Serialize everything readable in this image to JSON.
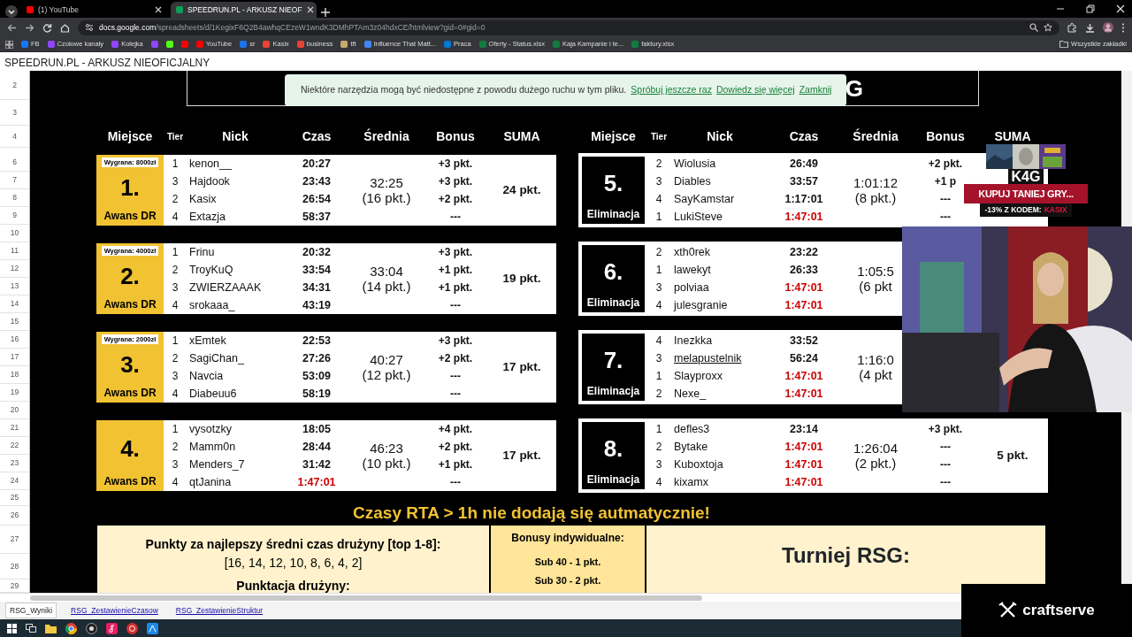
{
  "browser": {
    "tabs": [
      {
        "label": "(1) YouTube",
        "color": "#ff0000",
        "selected": false
      },
      {
        "label": "SPEEDRUN.PL - ARKUSZ NIEOF",
        "color": "#0f9d58",
        "selected": true
      }
    ],
    "url": {
      "host": "docs.google.com",
      "path": "/spreadsheets/d/1KegixF6Q2B4awhqCEzeW1wndK3DMhPTAm3z04hdxCE/htmlview?gid=0#gid=0"
    },
    "bookmarks": [
      {
        "label": "FB",
        "color": "#1877f2"
      },
      {
        "label": "Czołowe kanały",
        "color": "#9146ff"
      },
      {
        "label": "Kolejka",
        "color": "#9146ff"
      },
      {
        "color": "#9146ff"
      },
      {
        "color": "#53fc18"
      },
      {
        "color": "#ff0000"
      },
      {
        "label": "YouTube",
        "color": "#ff0000"
      },
      {
        "label": "sr",
        "color": "#1a73e8"
      },
      {
        "label": "Kasix",
        "color": "#ea4335"
      },
      {
        "label": "business",
        "color": "#ea4335"
      },
      {
        "label": "tft",
        "color": "#c8aa6e"
      },
      {
        "label": "Influence That Matt...",
        "color": "#4285f4"
      },
      {
        "label": "Praca",
        "color": "#0078d4"
      },
      {
        "label": "Oferty - Status.xlsx",
        "color": "#107c41"
      },
      {
        "label": "Kaja Kampanie i te...",
        "color": "#107c41"
      },
      {
        "label": "faktury.xlsx",
        "color": "#107c41"
      }
    ],
    "all_bookmarks": "Wszystkie zakładki"
  },
  "sheet": {
    "title": "SPEEDRUN.PL - ARKUSZ NIEOFICJALNY",
    "row_numbers": [
      "2",
      "3",
      "4",
      "6",
      "7",
      "8",
      "9",
      "10",
      "11",
      "12",
      "13",
      "14",
      "15",
      "16",
      "17",
      "18",
      "19",
      "20",
      "21",
      "22",
      "23",
      "24",
      "25",
      "26",
      "27",
      "28",
      "29"
    ],
    "banner": "G",
    "notice": {
      "text": "Niektóre narzędzia mogą być niedostępne z powodu dużego ruchu w tym pliku.",
      "links": [
        "Spróbuj jeszcze raz",
        "Dowiedz się więcej",
        "Zamknij"
      ]
    },
    "headers": [
      [
        "Miejsce",
        "Tier",
        "Nick",
        "Czas",
        "Średnia",
        "Bonus",
        "SUMA"
      ],
      [
        "Miejsce",
        "Tier",
        "Nick",
        "Czas",
        "Średnia",
        "Bonus",
        "SUMA"
      ]
    ],
    "teams": [
      {
        "place": "1.",
        "prize": "Wygrana: 8000zł",
        "status": "Awans DR",
        "kind": "advance",
        "average": "32:25",
        "avg_points": "(16 pkt.)",
        "total": "24 pkt.",
        "players": [
          {
            "tier": "1",
            "nick": "kenon__",
            "time": "20:27",
            "over_limit": false,
            "hovered": false,
            "bonus": "+3 pkt."
          },
          {
            "tier": "3",
            "nick": "Hajdook",
            "time": "23:43",
            "over_limit": false,
            "hovered": false,
            "bonus": "+3 pkt."
          },
          {
            "tier": "2",
            "nick": "Kasix",
            "time": "26:54",
            "over_limit": false,
            "hovered": false,
            "bonus": "+2 pkt."
          },
          {
            "tier": "4",
            "nick": "Extazja",
            "time": "58:37",
            "over_limit": false,
            "hovered": false,
            "bonus": "---"
          }
        ]
      },
      {
        "place": "2.",
        "prize": "Wygrana: 4000zł",
        "status": "Awans DR",
        "kind": "advance",
        "average": "33:04",
        "avg_points": "(14 pkt.)",
        "total": "19 pkt.",
        "players": [
          {
            "tier": "1",
            "nick": "Frinu",
            "time": "20:32",
            "over_limit": false,
            "hovered": false,
            "bonus": "+3 pkt."
          },
          {
            "tier": "2",
            "nick": "TroyKuQ",
            "time": "33:54",
            "over_limit": false,
            "hovered": false,
            "bonus": "+1 pkt."
          },
          {
            "tier": "3",
            "nick": "ZWIERZAAAK",
            "time": "34:31",
            "over_limit": false,
            "hovered": false,
            "bonus": "+1 pkt."
          },
          {
            "tier": "4",
            "nick": "srokaaa_",
            "time": "43:19",
            "over_limit": false,
            "hovered": false,
            "bonus": "---"
          }
        ]
      },
      {
        "place": "3.",
        "prize": "Wygrana: 2000zł",
        "status": "Awans DR",
        "kind": "advance",
        "average": "40:27",
        "avg_points": "(12 pkt.)",
        "total": "17 pkt.",
        "players": [
          {
            "tier": "1",
            "nick": "xEmtek",
            "time": "22:53",
            "over_limit": false,
            "hovered": false,
            "bonus": "+3 pkt."
          },
          {
            "tier": "2",
            "nick": "SagiChan_",
            "time": "27:26",
            "over_limit": false,
            "hovered": false,
            "bonus": "+2 pkt."
          },
          {
            "tier": "3",
            "nick": "Navcia",
            "time": "53:09",
            "over_limit": false,
            "hovered": false,
            "bonus": "---"
          },
          {
            "tier": "4",
            "nick": "Diabeuu6",
            "time": "58:19",
            "over_limit": false,
            "hovered": false,
            "bonus": "---"
          }
        ]
      },
      {
        "place": "4.",
        "status": "Awans DR",
        "kind": "advance",
        "average": "46:23",
        "avg_points": "(10 pkt.)",
        "total": "17 pkt.",
        "players": [
          {
            "tier": "1",
            "nick": "vysotzky",
            "time": "18:05",
            "over_limit": false,
            "hovered": false,
            "bonus": "+4 pkt."
          },
          {
            "tier": "2",
            "nick": "Mamm0n",
            "time": "28:44",
            "over_limit": false,
            "hovered": false,
            "bonus": "+2 pkt."
          },
          {
            "tier": "3",
            "nick": "Menders_7",
            "time": "31:42",
            "over_limit": false,
            "hovered": false,
            "bonus": "+1 pkt."
          },
          {
            "tier": "4",
            "nick": "qtJanina",
            "time": "1:47:01",
            "over_limit": true,
            "hovered": false,
            "bonus": "---"
          }
        ]
      },
      {
        "place": "5.",
        "status": "Eliminacja",
        "kind": "elimination",
        "average": "1:01:12",
        "avg_points": "(8 pkt.)",
        "players": [
          {
            "tier": "2",
            "nick": "Wiolusia",
            "time": "26:49",
            "over_limit": false,
            "hovered": false,
            "bonus": "+2 pkt."
          },
          {
            "tier": "3",
            "nick": "Diables",
            "time": "33:57",
            "over_limit": false,
            "hovered": false,
            "bonus": "+1 p"
          },
          {
            "tier": "4",
            "nick": "SayKamstar",
            "time": "1:17:01",
            "over_limit": false,
            "hovered": false,
            "bonus": "---"
          },
          {
            "tier": "1",
            "nick": "LukiSteve",
            "time": "1:47:01",
            "over_limit": true,
            "hovered": false,
            "bonus": "---"
          }
        ]
      },
      {
        "place": "6.",
        "status": "Eliminacja",
        "kind": "elimination",
        "average": "1:05:5",
        "avg_points": "(6 pkt",
        "players": [
          {
            "tier": "2",
            "nick": "xth0rek",
            "time": "23:22",
            "over_limit": false,
            "hovered": false
          },
          {
            "tier": "1",
            "nick": "lawekyt",
            "time": "26:33",
            "over_limit": false,
            "hovered": false
          },
          {
            "tier": "3",
            "nick": "polviaa",
            "time": "1:47:01",
            "over_limit": true,
            "hovered": false
          },
          {
            "tier": "4",
            "nick": "julesgranie",
            "time": "1:47:01",
            "over_limit": true,
            "hovered": false
          }
        ]
      },
      {
        "place": "7.",
        "status": "Eliminacja",
        "kind": "elimination",
        "average": "1:16:0",
        "avg_points": "(4 pkt",
        "players": [
          {
            "tier": "4",
            "nick": "Inezkka",
            "time": "33:52",
            "over_limit": false,
            "hovered": false
          },
          {
            "tier": "3",
            "nick": "melapustelnik",
            "time": "56:24",
            "over_limit": false,
            "hovered": true
          },
          {
            "tier": "1",
            "nick": "Slayproxx",
            "time": "1:47:01",
            "over_limit": true,
            "hovered": false
          },
          {
            "tier": "2",
            "nick": "Nexe_",
            "time": "1:47:01",
            "over_limit": true,
            "hovered": false
          }
        ]
      },
      {
        "place": "8.",
        "status": "Eliminacja",
        "kind": "elimination",
        "average": "1:26:04",
        "avg_points": "(2 pkt.)",
        "total": "5 pkt.",
        "players": [
          {
            "tier": "1",
            "nick": "defles3",
            "time": "23:14",
            "over_limit": false,
            "hovered": false,
            "bonus": "+3 pkt."
          },
          {
            "tier": "2",
            "nick": "Bytake",
            "time": "1:47:01",
            "over_limit": true,
            "hovered": false,
            "bonus": "---"
          },
          {
            "tier": "3",
            "nick": "Kuboxtoja",
            "time": "1:47:01",
            "over_limit": true,
            "hovered": false,
            "bonus": "---"
          },
          {
            "tier": "4",
            "nick": "kixamx",
            "time": "1:47:01",
            "over_limit": true,
            "hovered": false,
            "bonus": "---"
          }
        ]
      }
    ],
    "warning": "Czasy RTA > 1h nie dodają się autmatycznie!",
    "info": {
      "points_title": "Punkty za najlepszy średni czas drużyny [top 1-8]:",
      "points_values": "[16, 14, 12, 10, 8, 6, 4, 2]",
      "points_team": "Punktacja drużyny:",
      "bonus_title": "Bonusy indywidualne:",
      "bonus_rules": [
        "Sub 40 - 1 pkt.",
        "Sub 30 - 2 pkt."
      ],
      "tournament": "Turniej RSG:"
    },
    "sheet_tabs": [
      {
        "label": "RSG_Wyniki",
        "selected": true
      },
      {
        "label": "RSG_ZestawienieCzasow",
        "selected": false
      },
      {
        "label": "RSG_ZestawienieStruktur",
        "selected": false
      }
    ]
  },
  "overlays": {
    "ad": {
      "logo": "K4G",
      "headline": "KUPUJ TANIEJ GRY...",
      "code_label": "-13% Z KODEM:",
      "code": "KASIX"
    },
    "sponsor": {
      "logo": "craftserve"
    }
  }
}
